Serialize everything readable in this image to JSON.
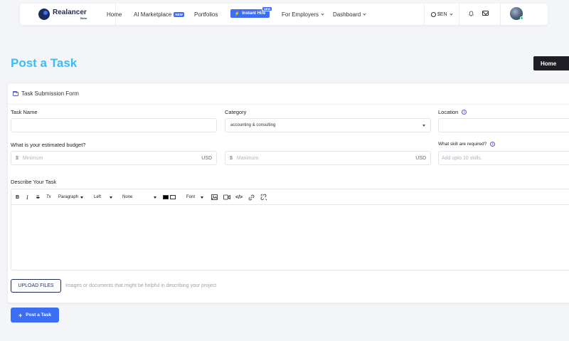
{
  "nav": {
    "brand": "Realancer",
    "brand_badge": "Beta",
    "links": {
      "home": "Home",
      "ai_marketplace": "AI Marketplace",
      "ai_marketplace_badge": "NEW",
      "portfolios": "Portfolios",
      "instant_hire": "Instant Hire",
      "instant_hire_badge": "NEW",
      "for_employers": "For Employers",
      "dashboard": "Dashboard"
    },
    "lang": "$EN",
    "icons": [
      "globe-icon",
      "bell-icon",
      "mail-icon"
    ]
  },
  "page": {
    "title": "Post a Task",
    "breadcrumb": "Home"
  },
  "form": {
    "header": "Task Submission Form",
    "task_name_label": "Task Name",
    "task_name_value": "",
    "category_label": "Category",
    "category_value": "accounting & consulting",
    "location_label": "Location",
    "location_value": "",
    "budget_label": "What is your estimated budget?",
    "budget_prefix": "$",
    "budget_min_placeholder": "Minimum",
    "budget_max_placeholder": "Maximum",
    "budget_currency": "USD",
    "skills_label": "What skill are required?",
    "skills_placeholder": "Add upto 10 skills.",
    "describe_label": "Describe Your Task",
    "editor": {
      "block_format": "Paragraph",
      "align": "Left",
      "spacing": "None",
      "font": "Font"
    },
    "upload_label": "UPLOAD FILES",
    "upload_hint": "Images or documents that might be helpful in describing your project",
    "submit_label": "Post a Task"
  },
  "colors": {
    "accent": "#3b6ef2",
    "title": "#38bdf8",
    "dark": "#1e1e24"
  }
}
